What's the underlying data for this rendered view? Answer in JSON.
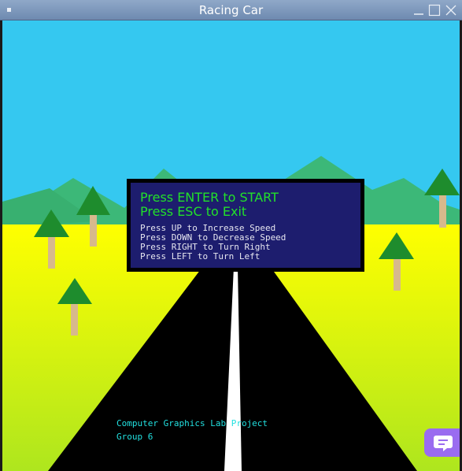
{
  "window": {
    "title": "Racing Car"
  },
  "menu_panel": {
    "start_line": "Press ENTER to START",
    "exit_line": "Press ESC to Exit",
    "controls": [
      "Press UP to Increase Speed",
      "Press DOWN to Decrease Speed",
      "Press RIGHT to Turn Right",
      "Press LEFT to Turn Left"
    ]
  },
  "credits": {
    "project": "Computer Graphics Lab Project",
    "group": "Group 6"
  },
  "colors": {
    "sky": "#35c8f0",
    "mountain": "#3cb878",
    "grass_top": "#ffff00",
    "grass_bottom": "#aee61e",
    "road": "#000000",
    "road_line": "#ffffff",
    "tree_top": "#1e8c2d",
    "tree_trunk": "#d7b98c",
    "panel_bg": "#1d1d6e",
    "panel_title": "#22e02a",
    "credits_text": "#22e0e0",
    "chat_button": "#9a6cf0"
  },
  "icons": {
    "window_icon": "app-dot-icon",
    "minimize": "minimize-icon",
    "maximize": "maximize-icon",
    "close": "close-icon",
    "chat": "chat-bubble-icon"
  }
}
